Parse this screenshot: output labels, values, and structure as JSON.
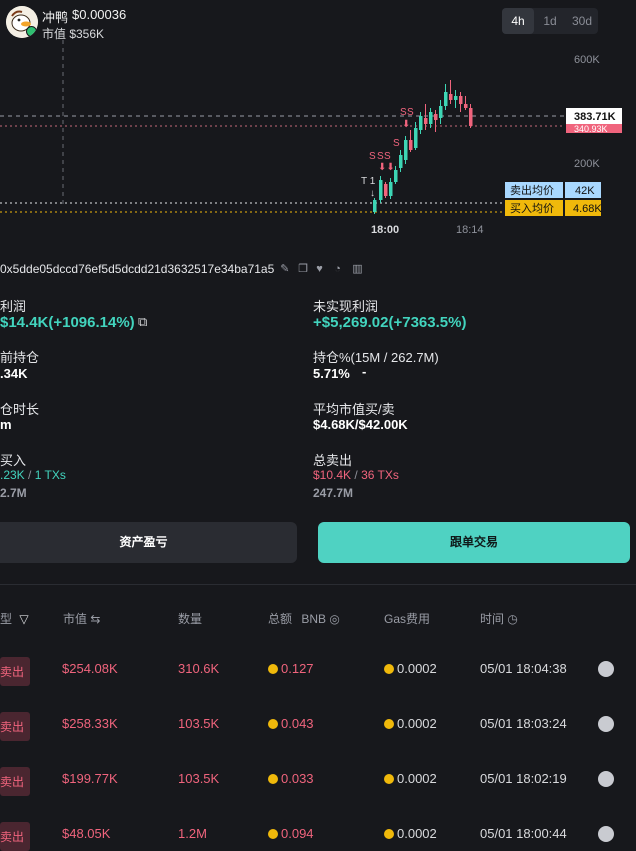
{
  "header": {
    "token_name": "冲鸭",
    "price": "$0.00036",
    "market_cap": "市值 $356K",
    "timeframes": [
      "4h",
      "1d",
      "30d"
    ],
    "active_timeframe": "4h"
  },
  "chart": {
    "y_ticks": [
      "600K",
      "200K"
    ],
    "x_ticks": [
      "18:00",
      "18:14"
    ],
    "price_tag": "383.71K",
    "price_tag_sub": "340.93K",
    "sell_avg_label": "卖出均价",
    "sell_avg_value": "42K",
    "buy_avg_label": "买入均价",
    "buy_avg_value": "4.68K",
    "colors": {
      "up": "#3dd6b5",
      "down": "#f0647d",
      "buy_line": "#f0b90b",
      "sell_line": "#e6e7ea"
    }
  },
  "wallet": {
    "address": "0x5dde05dccd76ef5d5dcdd21d3632517e34ba71a5"
  },
  "stats": {
    "profit_label": "利润",
    "profit_value": "$14.4K(+1096.14%)",
    "unrealized_label": "未实现利润",
    "unrealized_value": "+$5,269.02(+7363.5%)",
    "holding_label": "前持仓",
    "holding_value": ".34K",
    "holding_pct_label": "持仓%(15M / 262.7M)",
    "holding_pct_value": "5.71%",
    "holding_pct_dash": "-",
    "duration_label": "仓时长",
    "duration_value": "m",
    "avg_mcap_label": "平均市值买/卖",
    "avg_mcap_value": "$4.68K/$42.00K",
    "buy_label": "买入",
    "buy_amount": ".23K",
    "buy_sep": " / ",
    "buy_txs": "1 TXs",
    "buy_tokens": "2.7M",
    "sell_label": "总卖出",
    "sell_amount": "$10.4K",
    "sell_sep": " / ",
    "sell_txs": "36 TXs",
    "sell_tokens": "247.7M"
  },
  "actions": {
    "pnl_button": "资产盈亏",
    "copy_trade_button": "跟单交易"
  },
  "table": {
    "headers": {
      "type": "型",
      "mcap": "市值",
      "amount": "数量",
      "total": "总额",
      "total_unit": "BNB",
      "gas": "Gas费用",
      "time": "时间"
    },
    "rows": [
      {
        "type": "卖出",
        "mcap": "$254.08K",
        "amount": "310.6K",
        "total": "0.127",
        "gas": "0.0002",
        "time": "05/01 18:04:38"
      },
      {
        "type": "卖出",
        "mcap": "$258.33K",
        "amount": "103.5K",
        "total": "0.043",
        "gas": "0.0002",
        "time": "05/01 18:03:24"
      },
      {
        "type": "卖出",
        "mcap": "$199.77K",
        "amount": "103.5K",
        "total": "0.033",
        "gas": "0.0002",
        "time": "05/01 18:02:19"
      },
      {
        "type": "卖出",
        "mcap": "$48.05K",
        "amount": "1.2M",
        "total": "0.094",
        "gas": "0.0002",
        "time": "05/01 18:00:44"
      }
    ]
  }
}
